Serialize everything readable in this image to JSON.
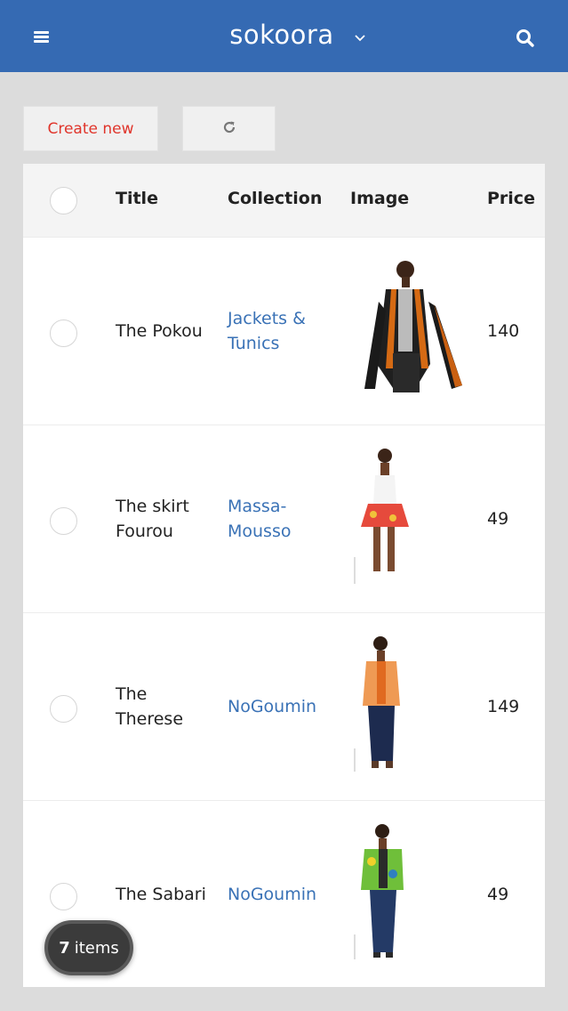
{
  "app": {
    "brand": "sokoora"
  },
  "toolbar": {
    "create_label": "Create new"
  },
  "table": {
    "columns": [
      "Title",
      "Collection",
      "Image",
      "Price"
    ],
    "rows": [
      {
        "title": "The Pokou",
        "collection": "Jackets & Tunics",
        "image": "model-black-jacket-orange-scarf",
        "price": "140"
      },
      {
        "title": "The skirt Fourou",
        "collection": "Massa-Mousso",
        "image": "model-white-top-red-skirt",
        "price": "49"
      },
      {
        "title": "The Therese",
        "collection": "NoGoumin",
        "image": "model-orange-jacket-navy-pants",
        "price": "149"
      },
      {
        "title": "The Sabari",
        "collection": "NoGoumin",
        "image": "model-green-print-jacket-jeans",
        "price": "49"
      }
    ]
  },
  "footer": {
    "count": "7",
    "count_label": "items"
  },
  "colors": {
    "header_bg": "#356ab3",
    "accent_red": "#e0352b",
    "link_blue": "#3a72b6"
  }
}
